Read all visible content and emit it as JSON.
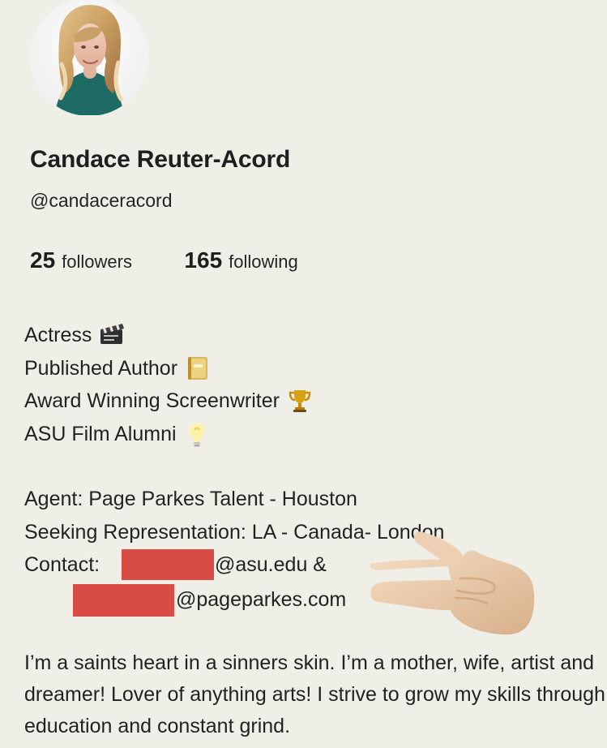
{
  "profile": {
    "name": "Candace Reuter-Acord",
    "handle": "@candaceracord",
    "followers_count": "25",
    "followers_label": "followers",
    "following_count": "165",
    "following_label": "following"
  },
  "bio": {
    "lines": [
      {
        "text": "Actress",
        "icon": "clapper-board-icon"
      },
      {
        "text": "Published Author",
        "icon": "notebook-icon"
      },
      {
        "text": "Award Winning Screenwriter",
        "icon": "trophy-icon"
      },
      {
        "text": "ASU Film Alumni",
        "icon": "lightbulb-icon"
      }
    ],
    "agent": "Agent: Page Parkes Talent - Houston",
    "seeking": "Seeking Representation: LA - Canada- London",
    "contact_label": "Contact:",
    "contact_email_1": "@asu.edu &",
    "contact_email_2": "@pageparkes.com",
    "paragraph": "I’m a saints heart in a sinners skin. I’m a mother, wife, artist and dreamer! Lover of anything arts! I strive to grow my skills through education and constant grind."
  },
  "colors": {
    "background": "#f0efe7",
    "redaction": "#d94c45",
    "text": "#222222"
  },
  "icons": {
    "avatar": "profile-photo",
    "pointing_hand": "pointing-hand-icon"
  }
}
